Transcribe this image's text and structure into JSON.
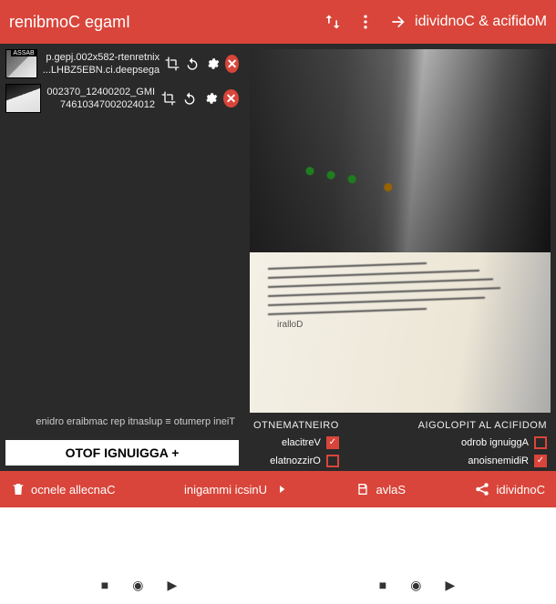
{
  "header": {
    "app_title": "Image Combiner",
    "action_title": "Modifica & Condividi"
  },
  "files": [
    {
      "line1": "xinternetr-285x200.jpeg.p",
      "line2": "agespeed.ic.NBE5ZBHL...",
      "badge": "BASSA"
    },
    {
      "line1": "IMG_20200421_073200",
      "line2": "21042020074301647"
    }
  ],
  "left": {
    "hint": "Tieni premuto ≡ pulsanti per cambiare ordine",
    "add_button": "+ AGGIUNGI FOTO"
  },
  "options": {
    "orientation_header": "ORIENTAMENTO",
    "vertical": "Verticale",
    "horizontal": "Orizzontale",
    "modify_header": "MODIFICA LA TIPOLOGIA",
    "add_border": "Aggiungi bordo",
    "resize": "Ridimensiona"
  },
  "bottom": {
    "delete_list": "Cancella elenco",
    "merge": "Unisci immagini",
    "save": "Salva",
    "share": "Condividi"
  },
  "paper_caption": "Dollari",
  "colors": {
    "accent": "#d9453a"
  }
}
